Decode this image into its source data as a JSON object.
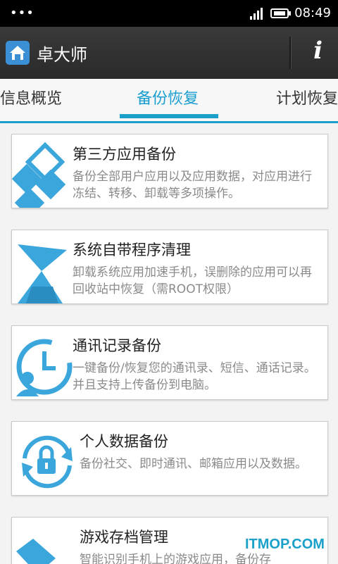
{
  "status_bar": {
    "time": "08:49",
    "dots": "•••"
  },
  "app_bar": {
    "title": "卓大师",
    "info_symbol": "i"
  },
  "tabs": [
    {
      "label": "信息概览"
    },
    {
      "label": "备份恢复"
    },
    {
      "label": "计划恢复"
    }
  ],
  "cards": [
    {
      "title": "第三方应用备份",
      "desc": "备份全部用户应用以及应用数据，对应用进行冻结、转移、卸载等多项操作。"
    },
    {
      "title": "系统自带程序清理",
      "desc": "卸载系统应用加速手机，误删除的应用可以再回收站中恢复（需ROOT权限）"
    },
    {
      "title": "通讯记录备份",
      "desc": "一键备份/恢复您的通讯录、短信、通话记录。并且支持上传备份到电脑。"
    },
    {
      "title": "个人数据备份",
      "desc": "备份社交、即时通讯、邮箱应用以及数据。"
    },
    {
      "title": "游戏存档管理",
      "desc": "智能识别手机上的游戏应用，备份存"
    }
  ],
  "watermark": "ITMOP.COM",
  "colors": {
    "accent": "#1aa0c9",
    "icon": "#3aa6dc"
  }
}
